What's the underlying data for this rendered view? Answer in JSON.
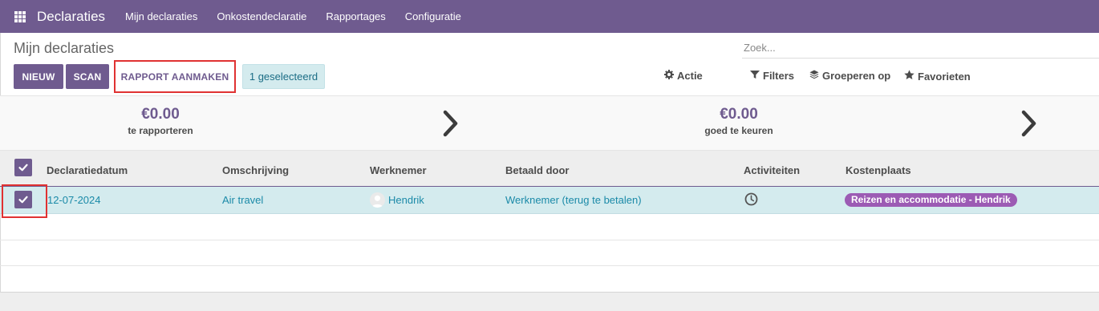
{
  "navbar": {
    "brand": "Declaraties",
    "items": [
      {
        "label": "Mijn declaraties"
      },
      {
        "label": "Onkostendeclaratie"
      },
      {
        "label": "Rapportages"
      },
      {
        "label": "Configuratie"
      }
    ],
    "color": "#6f5b8f"
  },
  "control_panel": {
    "title": "Mijn declaraties",
    "search_placeholder": "Zoek...",
    "buttons": {
      "new": "NIEUW",
      "scan": "SCAN",
      "report": "RAPPORT AANMAKEN"
    },
    "selected": "1 geselecteerd",
    "actie": "Actie",
    "filters": "Filters",
    "group_by": "Groeperen op",
    "favorites": "Favorieten"
  },
  "summary": [
    {
      "amount": "€0.00",
      "label": "te rapporteren"
    },
    {
      "amount": "€0.00",
      "label": "goed te keuren"
    }
  ],
  "table": {
    "columns": [
      "Declaratiedatum",
      "Omschrijving",
      "Werknemer",
      "Betaald door",
      "Activiteiten",
      "Kostenplaats"
    ],
    "rows": [
      {
        "date": "12-07-2024",
        "description": "Air travel",
        "employee": "Hendrik",
        "paid_by": "Werknemer (terug te betalen)",
        "activity_icon": "clock-icon",
        "cost_center": "Reizen en accommodatie - Hendrik",
        "selected": true
      }
    ]
  },
  "colors": {
    "accent": "#6f5b8f",
    "selected_row": "#d4ebee",
    "link": "#1b8aa8",
    "tag": "#9c5bb4",
    "highlight_frame": "#e03232"
  }
}
